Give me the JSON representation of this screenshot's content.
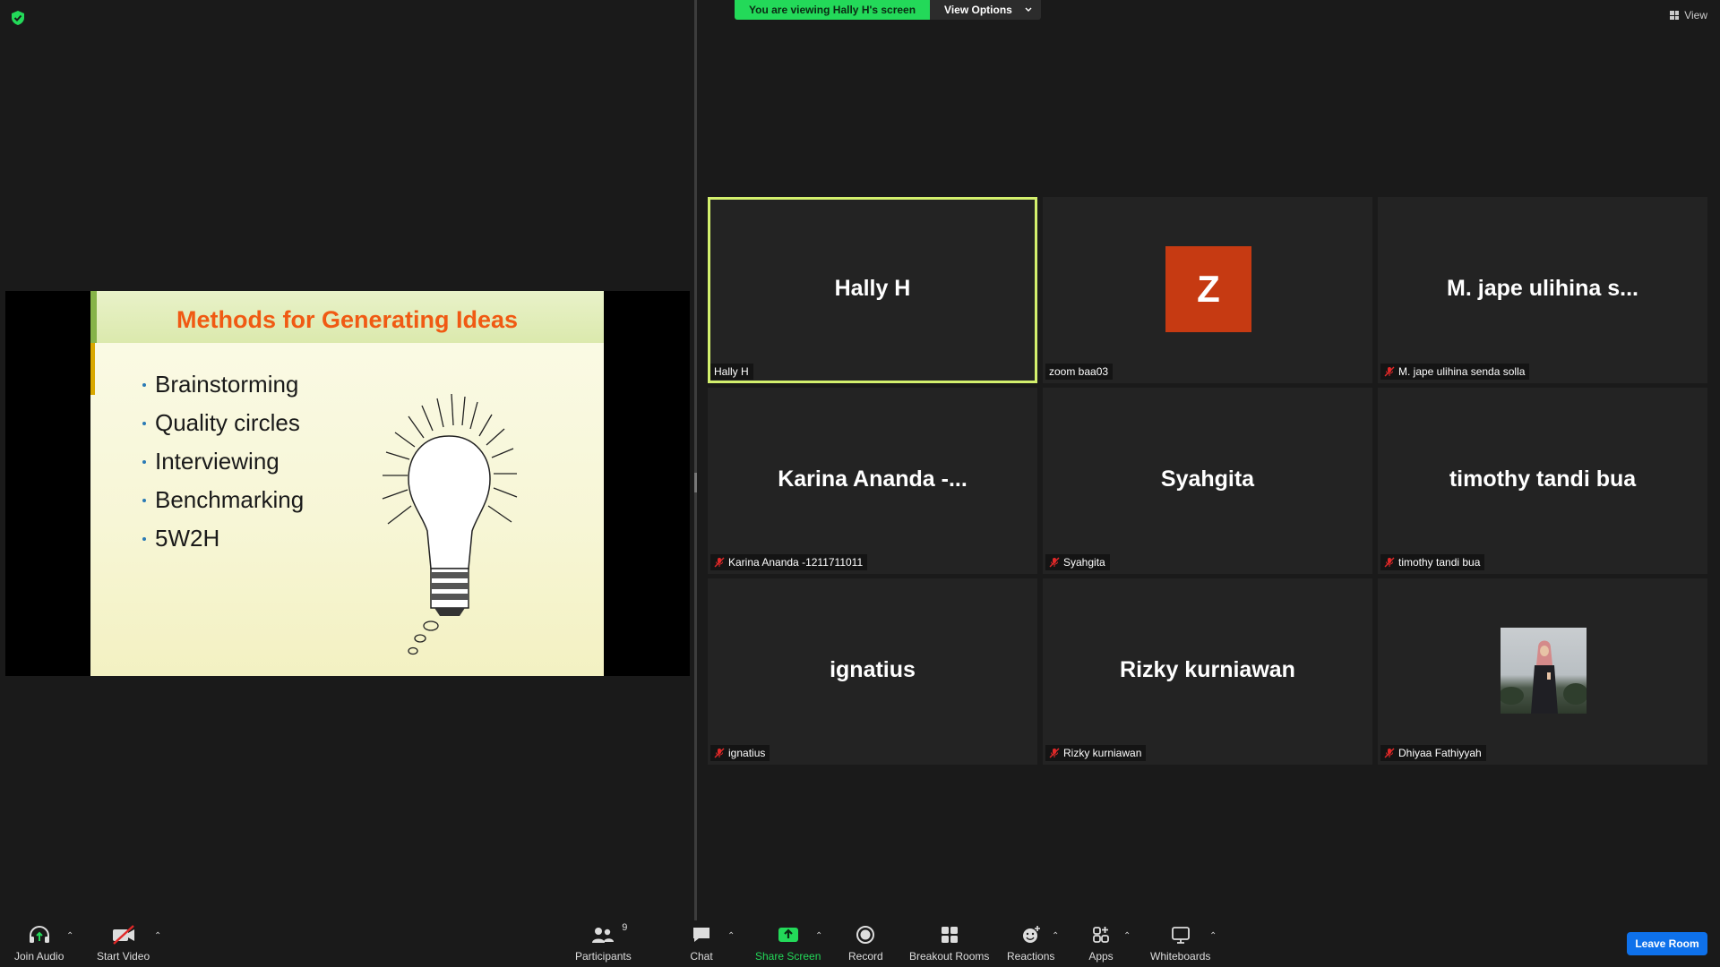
{
  "top_bar": {
    "banner_text": "You are viewing Hally H's screen",
    "view_options_label": "View Options",
    "view_label": "View",
    "colors": {
      "security": "#23d959",
      "banner": "#23d959"
    }
  },
  "slide": {
    "title": "Methods for Generating Ideas",
    "bullets": [
      "Brainstorming",
      "Quality circles",
      "Interviewing",
      "Benchmarking",
      "5W2H"
    ],
    "colors": {
      "title": "#f05a13",
      "bullet": "#2a7ab5"
    }
  },
  "participants": [
    {
      "display_name": "Hally H",
      "label": "Hally H",
      "muted": false,
      "active_speaker": true
    },
    {
      "avatar_letter": "Z",
      "label": "zoom baa03",
      "muted": false
    },
    {
      "display_name": "M. jape ulihina s...",
      "label": "M. jape ulihina senda solla",
      "muted": true
    },
    {
      "display_name": "Karina Ananda -...",
      "label": "Karina Ananda -1211711011",
      "muted": true
    },
    {
      "display_name": "Syahgita",
      "label": "Syahgita",
      "muted": true
    },
    {
      "display_name": "timothy tandi bua",
      "label": "timothy tandi bua",
      "muted": true
    },
    {
      "display_name": "ignatius",
      "label": "ignatius",
      "muted": true
    },
    {
      "display_name": "Rizky kurniawan",
      "label": "Rizky kurniawan",
      "muted": true
    },
    {
      "label": "Dhiyaa Fathiyyah",
      "muted": true,
      "has_photo": true
    }
  ],
  "toolbar": {
    "join_audio": "Join Audio",
    "start_video": "Start Video",
    "participants": "Participants",
    "participants_count": "9",
    "chat": "Chat",
    "share_screen": "Share Screen",
    "record": "Record",
    "breakout_rooms": "Breakout Rooms",
    "reactions": "Reactions",
    "apps": "Apps",
    "whiteboards": "Whiteboards",
    "leave_room": "Leave Room",
    "colors": {
      "share": "#23d959",
      "leave": "#0e71eb",
      "video_off": "#e02828"
    }
  }
}
